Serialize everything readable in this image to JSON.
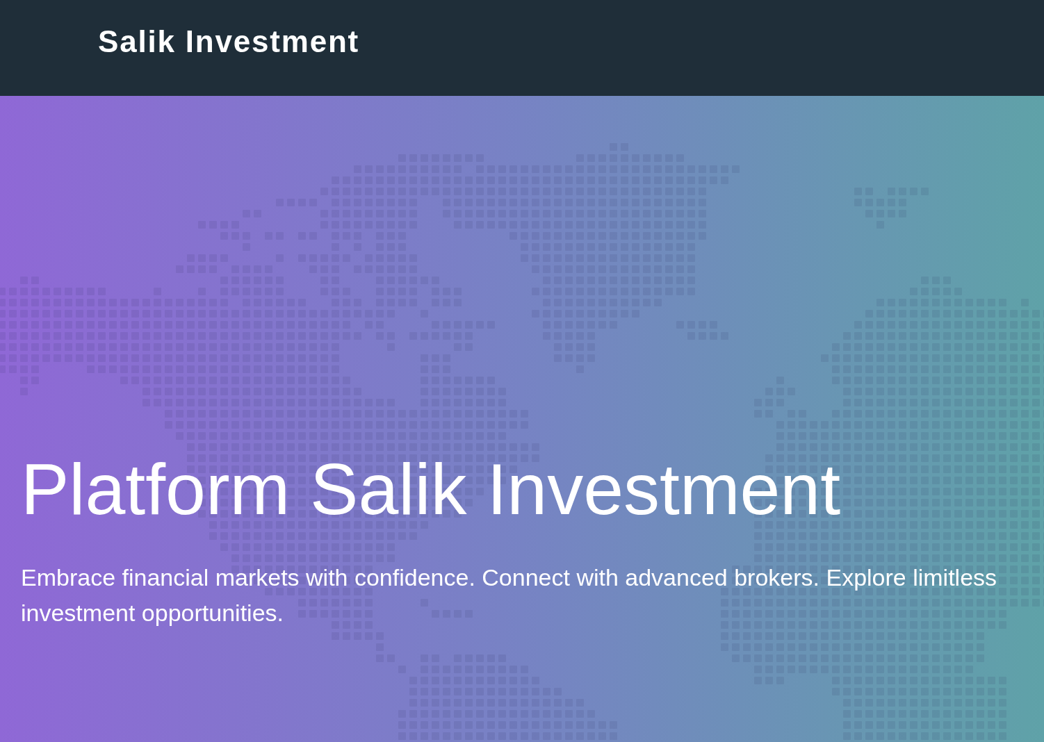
{
  "header": {
    "brand": "Salik Investment"
  },
  "hero": {
    "title": "Platform Salik Investment",
    "subtitle": "Embrace financial markets with confidence. Connect with advanced brokers. Explore limitless investment opportunities."
  }
}
